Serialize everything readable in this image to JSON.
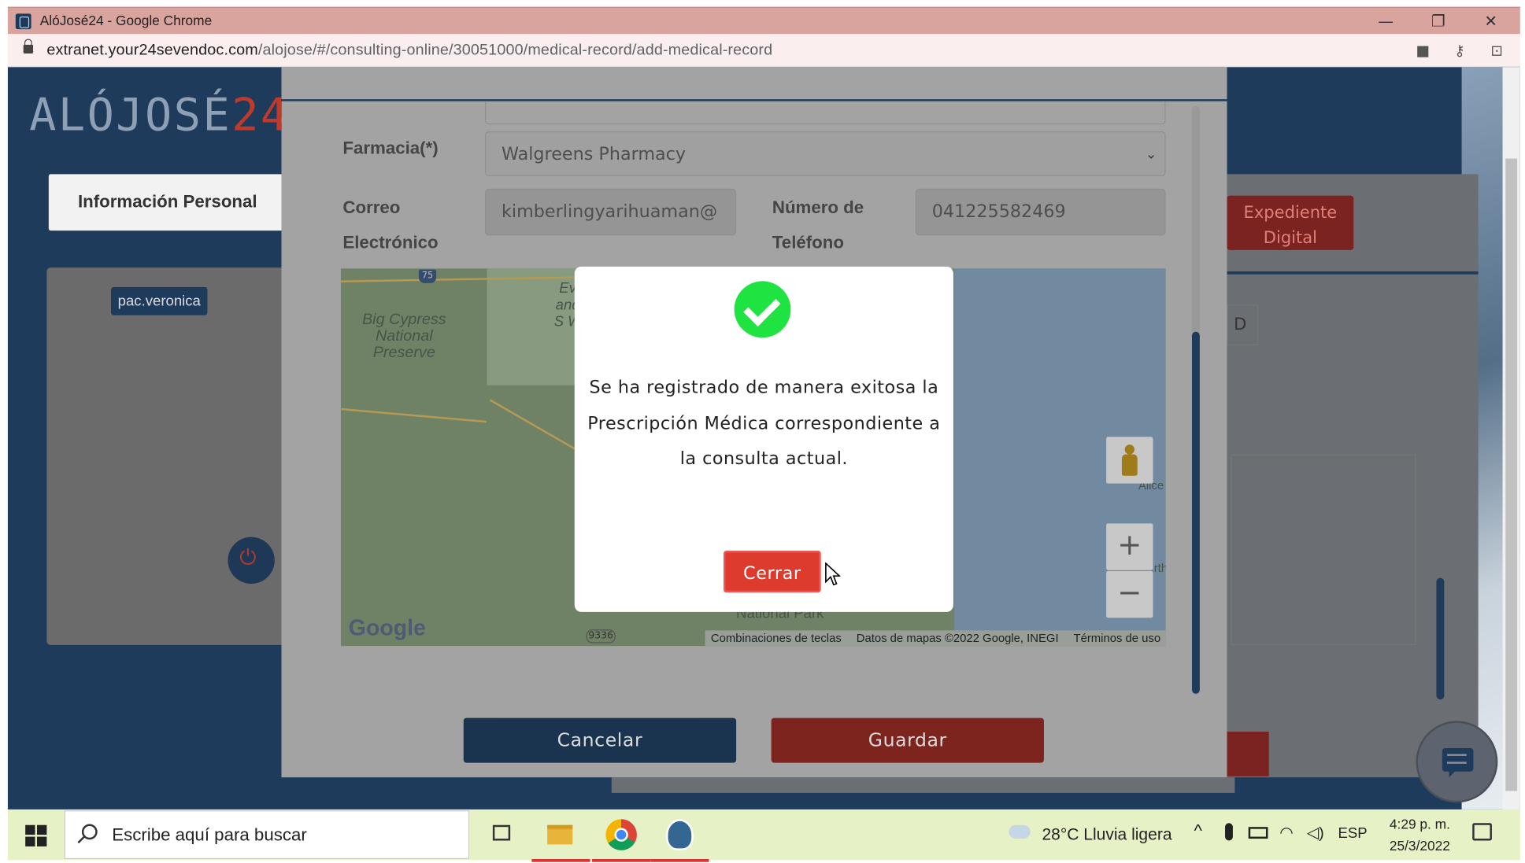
{
  "browser": {
    "window_title": "AlóJosé24 - Google Chrome",
    "url_domain": "extranet.your24sevendoc.com",
    "url_path": "/alojose/#/consulting-online/30051000/medical-record/add-medical-record",
    "minimize": "—",
    "restore": "❐",
    "close": "✕"
  },
  "background": {
    "logo_main": "ALÓJOSÉ",
    "logo_num": "24",
    "tab_label": "Información Personal",
    "user_badge": "pac.veronica",
    "expediente_button": "Expediente Digital",
    "d_field": "D"
  },
  "modal": {
    "farmacia_label": "Farmacia(*)",
    "farmacia_value": "Walgreens Pharmacy",
    "correo_label": "Correo Electrónico",
    "correo_value": "kimberlingyarihuaman@",
    "telefono_label": "Número de Teléfono",
    "telefono_value": "041225582469",
    "cancel_label": "Cancelar",
    "save_label": "Guardar"
  },
  "map": {
    "place_big_cypress": "Big Cypress National Preserve",
    "place_everglades_fragment": "Ev and S W",
    "place_national_park": "National Park",
    "place_alice": "Alice",
    "place_rth": "rth",
    "route_75": "75",
    "route_9336": "9336",
    "google_logo": "Google",
    "keyboard_shortcuts": "Combinaciones de teclas",
    "map_data": "Datos de mapas ©2022 Google, INEGI",
    "terms": "Términos de uso",
    "zoom_in": "+",
    "zoom_out": "−"
  },
  "dialog": {
    "message": "Se ha registrado de manera exitosa la Prescripción Médica correspondiente a la consulta actual.",
    "close_label": "Cerrar"
  },
  "taskbar": {
    "search_placeholder": "Escribe aquí para buscar",
    "weather": "28°C  Lluvia ligera",
    "language": "ESP",
    "time": "4:29 p. m.",
    "date": "25/3/2022"
  }
}
